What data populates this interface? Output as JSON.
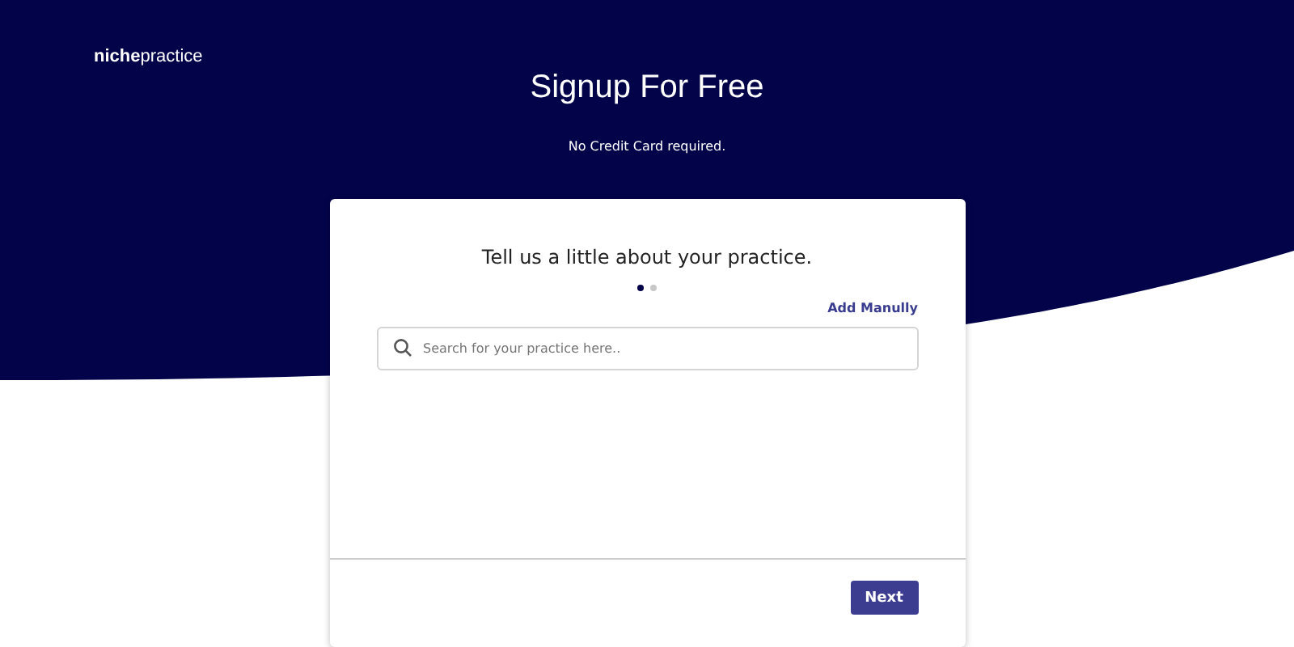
{
  "logo": "**niche**practice",
  "title": "Signup For Free",
  "subtitle": "No Credit Card required.",
  "card": {
    "heading": "Tell us a little about your practice.",
    "steps": [
      {
        "selected": true
      },
      {
        "selected": false
      }
    ],
    "add_link": "Add Manully",
    "search": {
      "placeholder": "Search for your practice here.."
    },
    "next_button": "Next"
  }
}
